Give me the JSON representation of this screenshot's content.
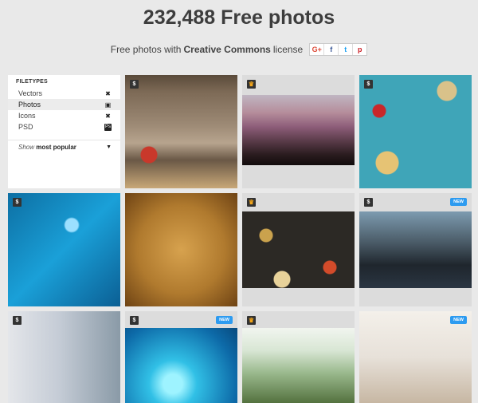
{
  "header": {
    "title": "232,488 Free photos",
    "subtitle_prefix": "Free photos with",
    "subtitle_strong": "Creative Commons",
    "subtitle_suffix": "license",
    "share": [
      "G+",
      "f",
      "t",
      "p"
    ]
  },
  "sidebar": {
    "heading": "FILETYPES",
    "items": [
      {
        "label": "Vectors",
        "icon": "vector-icon",
        "glyph": "✖"
      },
      {
        "label": "Photos",
        "icon": "photo-icon",
        "glyph": "▣",
        "active": true
      },
      {
        "label": "Icons",
        "icon": "icon-set-icon",
        "glyph": "✖"
      },
      {
        "label": "PSD",
        "icon": "psd-icon",
        "glyph": "Ps"
      }
    ],
    "sort_prefix": "Show",
    "sort_value": "most popular"
  },
  "tiles": [
    {
      "badge": "$",
      "badge_type": "dollar",
      "new": ""
    },
    {
      "badge": "♛",
      "badge_type": "crown",
      "new": ""
    },
    {
      "badge": "$",
      "badge_type": "dollar",
      "new": ""
    },
    {
      "badge": "$",
      "badge_type": "dollar",
      "new": ""
    },
    {
      "badge": "",
      "badge_type": "none",
      "new": ""
    },
    {
      "badge": "♛",
      "badge_type": "crown",
      "new": ""
    },
    {
      "badge": "$",
      "badge_type": "dollar",
      "new": "NEW"
    },
    {
      "badge": "$",
      "badge_type": "dollar",
      "new": ""
    },
    {
      "badge": "$",
      "badge_type": "dollar",
      "new": "NEW"
    },
    {
      "badge": "♛",
      "badge_type": "crown",
      "new": ""
    },
    {
      "badge": "",
      "badge_type": "none",
      "new": "NEW"
    }
  ],
  "colors": {
    "background": "#e9e9e9",
    "new_badge": "#2d9bf0",
    "crown": "#f2a51a"
  }
}
